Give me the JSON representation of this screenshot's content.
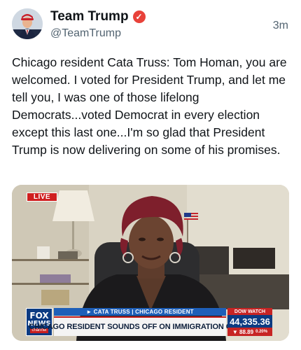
{
  "post": {
    "display_name": "Team Trump",
    "handle": "@TeamTrump",
    "timestamp": "3m",
    "text": "Chicago resident Cata Truss: Tom Homan, you are welcomed. I voted for President Trump, and let me tell you, I was one of those lifelong Democrats...voted Democrat in every election except this last one...I'm so glad that President Trump is now delivering on some of his promises.",
    "verified_badge_icon": "verified-check-icon",
    "verified_badge_color": "#e8423a"
  },
  "video": {
    "live_label": "LIVE",
    "channel_logo": {
      "line1": "FOX",
      "line2": "NEWS",
      "line3": "channel"
    },
    "name_strap": "► CATA TRUSS | CHICAGO RESIDENT",
    "headline": "CHICAGO RESIDENT SOUNDS OFF ON IMMIGRATION CRISIS",
    "ticker": {
      "label": "DOW WATCH",
      "value": "44,335.36",
      "change": "▼ 88.89",
      "change_pct": "0.20%"
    },
    "colors": {
      "fox_blue": "#0c3b82",
      "strap_blue": "#1e5fb8",
      "alert_red": "#c72424"
    }
  }
}
